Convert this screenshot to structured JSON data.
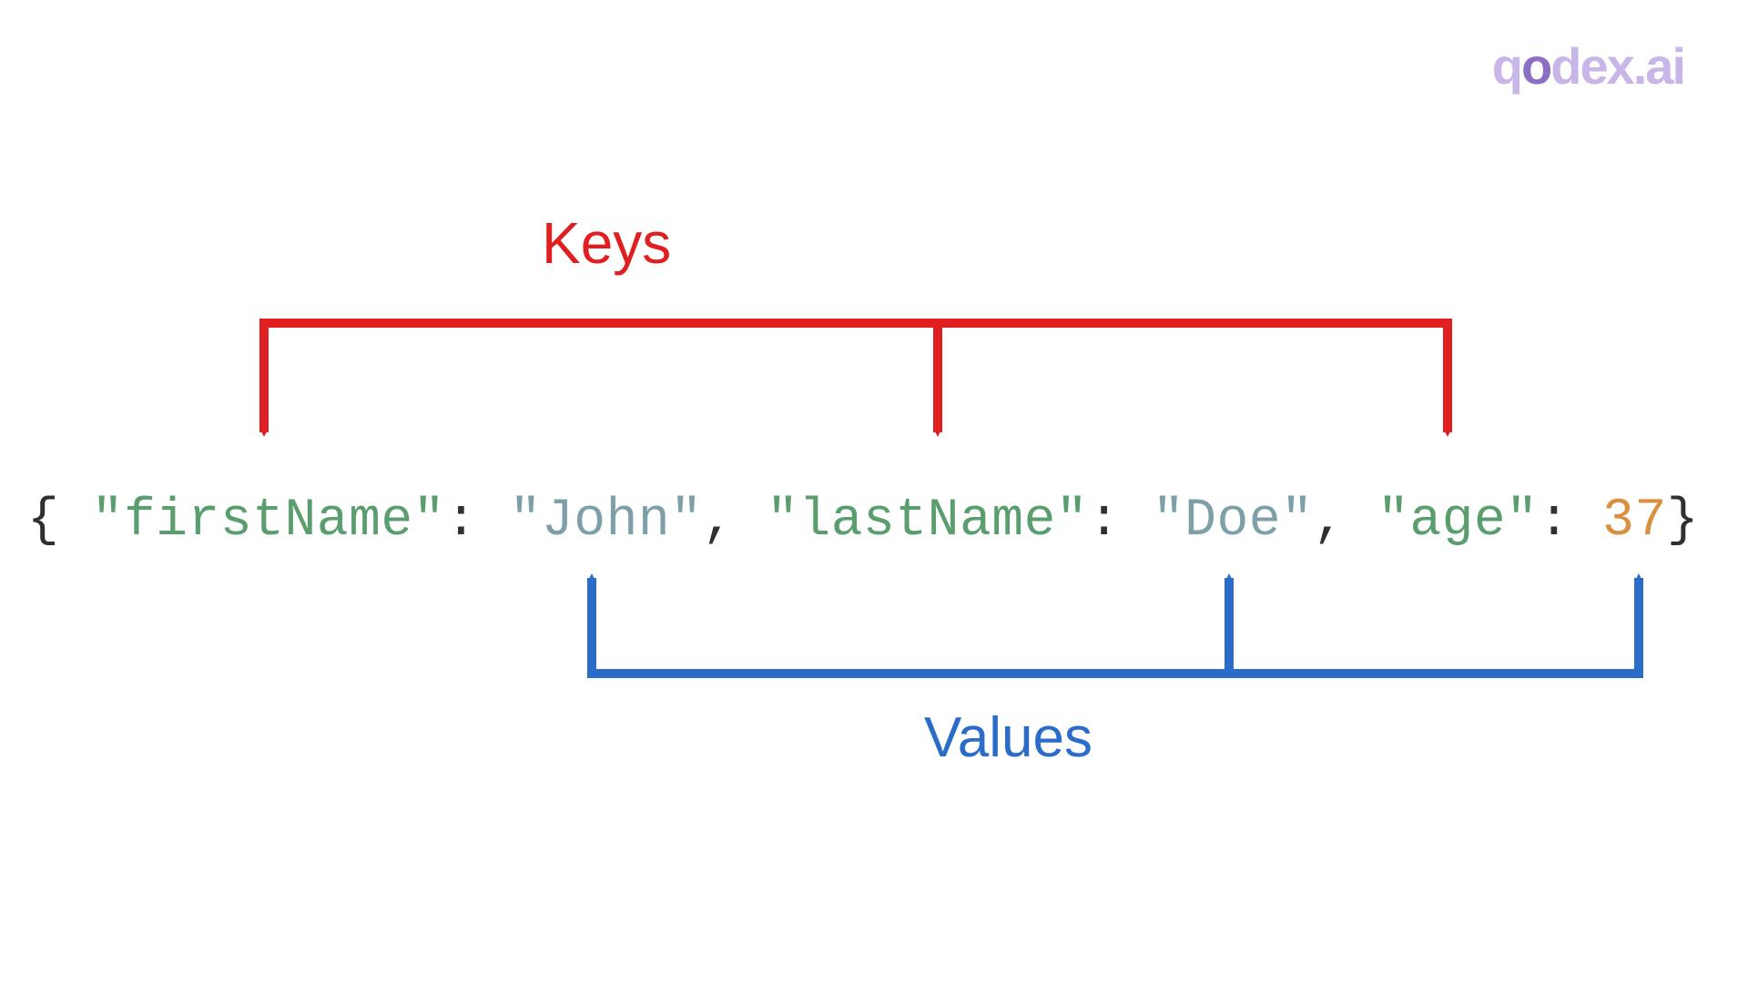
{
  "logo": {
    "text_q": "q",
    "text_o": "o",
    "text_dex": "dex",
    "text_dot": ".",
    "text_ai": "ai"
  },
  "labels": {
    "keys": "Keys",
    "values": "Values"
  },
  "json_example": {
    "open_brace": "{",
    "close_brace": "}",
    "pairs": [
      {
        "key": "firstName",
        "value": "John",
        "value_type": "string"
      },
      {
        "key": "lastName",
        "value": "Doe",
        "value_type": "string"
      },
      {
        "key": "age",
        "value": "37",
        "value_type": "number"
      }
    ],
    "colon": ":",
    "comma": ",",
    "quote": "\""
  },
  "colors": {
    "keys_arrow": "#e02020",
    "values_arrow": "#2a6cc8",
    "key_text": "#5a9e6f",
    "string_value": "#7da0a8",
    "number_value": "#d89040",
    "punctuation": "#303030"
  }
}
